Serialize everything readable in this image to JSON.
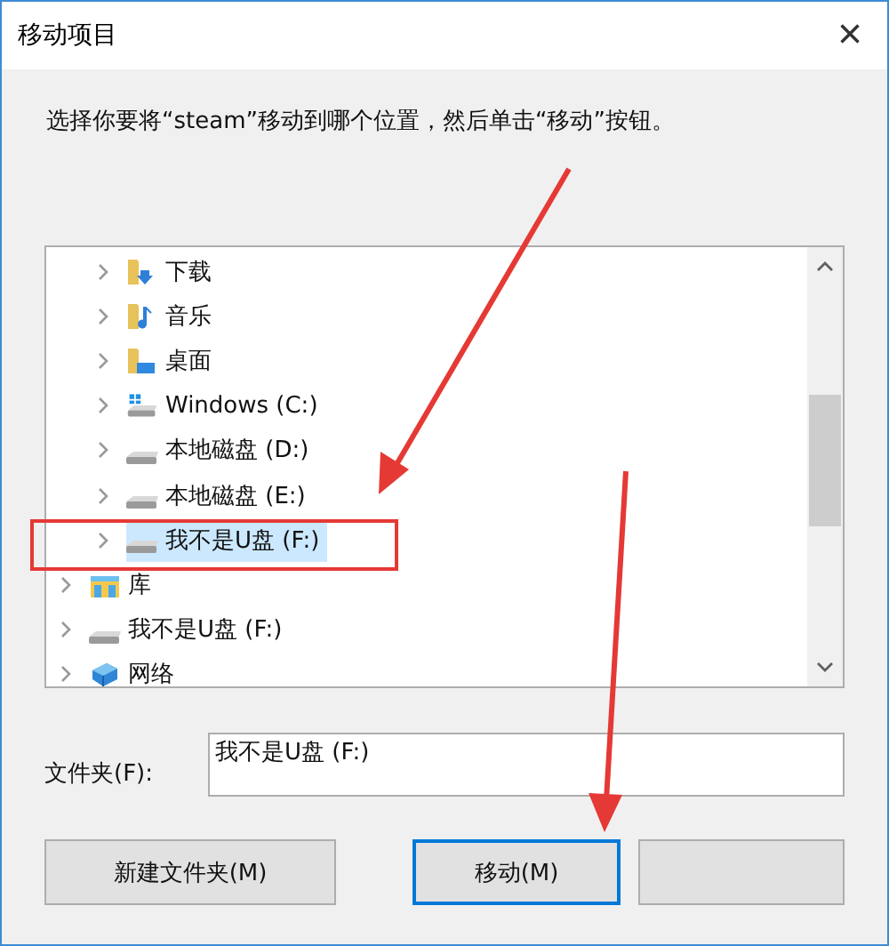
{
  "window": {
    "title": "移动项目",
    "close": "×"
  },
  "instruction": "选择你要将“steam”移动到哪个位置，然后单击“移动”按钮。",
  "tree": {
    "items": [
      {
        "children": [
          {
            "label": "下载",
            "kind": "download-folder",
            "selected": false
          },
          {
            "label": "音乐",
            "kind": "music-folder",
            "selected": false
          },
          {
            "label": "桌面",
            "kind": "desktop-folder",
            "selected": false
          },
          {
            "label": "Windows (C:)",
            "kind": "system-drive",
            "selected": false
          },
          {
            "label": "本地磁盘 (D:)",
            "kind": "drive",
            "selected": false
          },
          {
            "label": "本地磁盘 (E:)",
            "kind": "drive",
            "selected": false
          },
          {
            "label": "我不是U盘 (F:)",
            "kind": "drive",
            "selected": true
          }
        ]
      },
      {
        "label": "库",
        "kind": "library",
        "selected": false
      },
      {
        "label": "我不是U盘 (F:)",
        "kind": "drive",
        "selected": false
      },
      {
        "label": "网络",
        "kind": "network",
        "selected": false
      }
    ]
  },
  "folder": {
    "label": "文件夹(F):",
    "value": "我不是U盘 (F:)"
  },
  "buttons": [
    {
      "label": "新建文件夹(M)",
      "default": false
    },
    {
      "label": "移动(M)",
      "default": true
    },
    {
      "default": false
    }
  ]
}
